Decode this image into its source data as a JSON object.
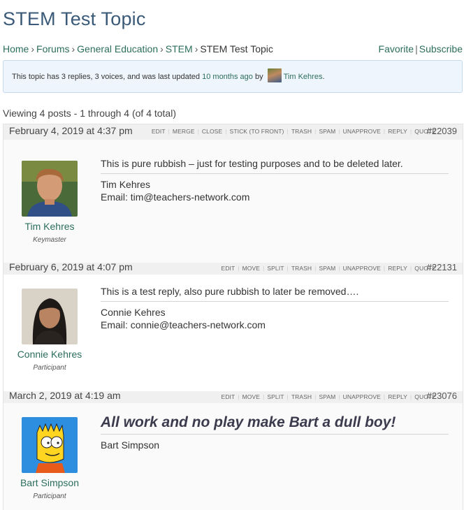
{
  "page": {
    "title": "STEM Test Topic"
  },
  "breadcrumb": {
    "items": [
      "Home",
      "Forums",
      "General Education",
      "STEM"
    ],
    "separator": "›",
    "current": "STEM Test Topic"
  },
  "topic_actions": {
    "favorite": "Favorite",
    "divider": "|",
    "subscribe": "Subscribe"
  },
  "notice": {
    "text_before": "This topic has 3 replies, 3 voices, and was last updated ",
    "time_link": "10 months ago",
    "text_by": " by ",
    "user_link": "Tim Kehres",
    "text_after": "."
  },
  "pagination": {
    "summary": "Viewing 4 posts - 1 through 4 (of 4 total)"
  },
  "posts": [
    {
      "date": "February 4, 2019 at 4:37 pm",
      "actions": [
        "EDIT",
        "MERGE",
        "CLOSE",
        "STICK (TO FRONT)",
        "TRASH",
        "SPAM",
        "UNAPPROVE",
        "REPLY",
        "QUOTE"
      ],
      "id": "#22039",
      "author": "Tim Kehres",
      "role": "Keymaster",
      "content": "This is pure rubbish – just for testing purposes and to be deleted later.",
      "signature": [
        "Tim Kehres",
        "Email: tim@teachers-network.com"
      ]
    },
    {
      "date": "February 6, 2019 at 4:07 pm",
      "actions": [
        "EDIT",
        "MOVE",
        "SPLIT",
        "TRASH",
        "SPAM",
        "UNAPPROVE",
        "REPLY",
        "QUOTE"
      ],
      "id": "#22131",
      "author": "Connie Kehres",
      "role": "Participant",
      "content": "This is a test reply, also pure rubbish to later be removed….",
      "signature": [
        "Connie Kehres",
        "Email: connie@teachers-network.com"
      ]
    },
    {
      "date": "March 2, 2019 at 4:19 am",
      "actions": [
        "EDIT",
        "MOVE",
        "SPLIT",
        "TRASH",
        "SPAM",
        "UNAPPROVE",
        "REPLY",
        "QUOTE"
      ],
      "id": "#23076",
      "author": "Bart Simpson",
      "role": "Participant",
      "content": "All work and no play make Bart a dull boy!",
      "signature": [
        "Bart Simpson"
      ]
    }
  ],
  "colors": {
    "link": "#2c6e5c",
    "title": "#3a5a78",
    "notice_bg": "#eef5fc",
    "header_bg": "#f0f0f0"
  }
}
